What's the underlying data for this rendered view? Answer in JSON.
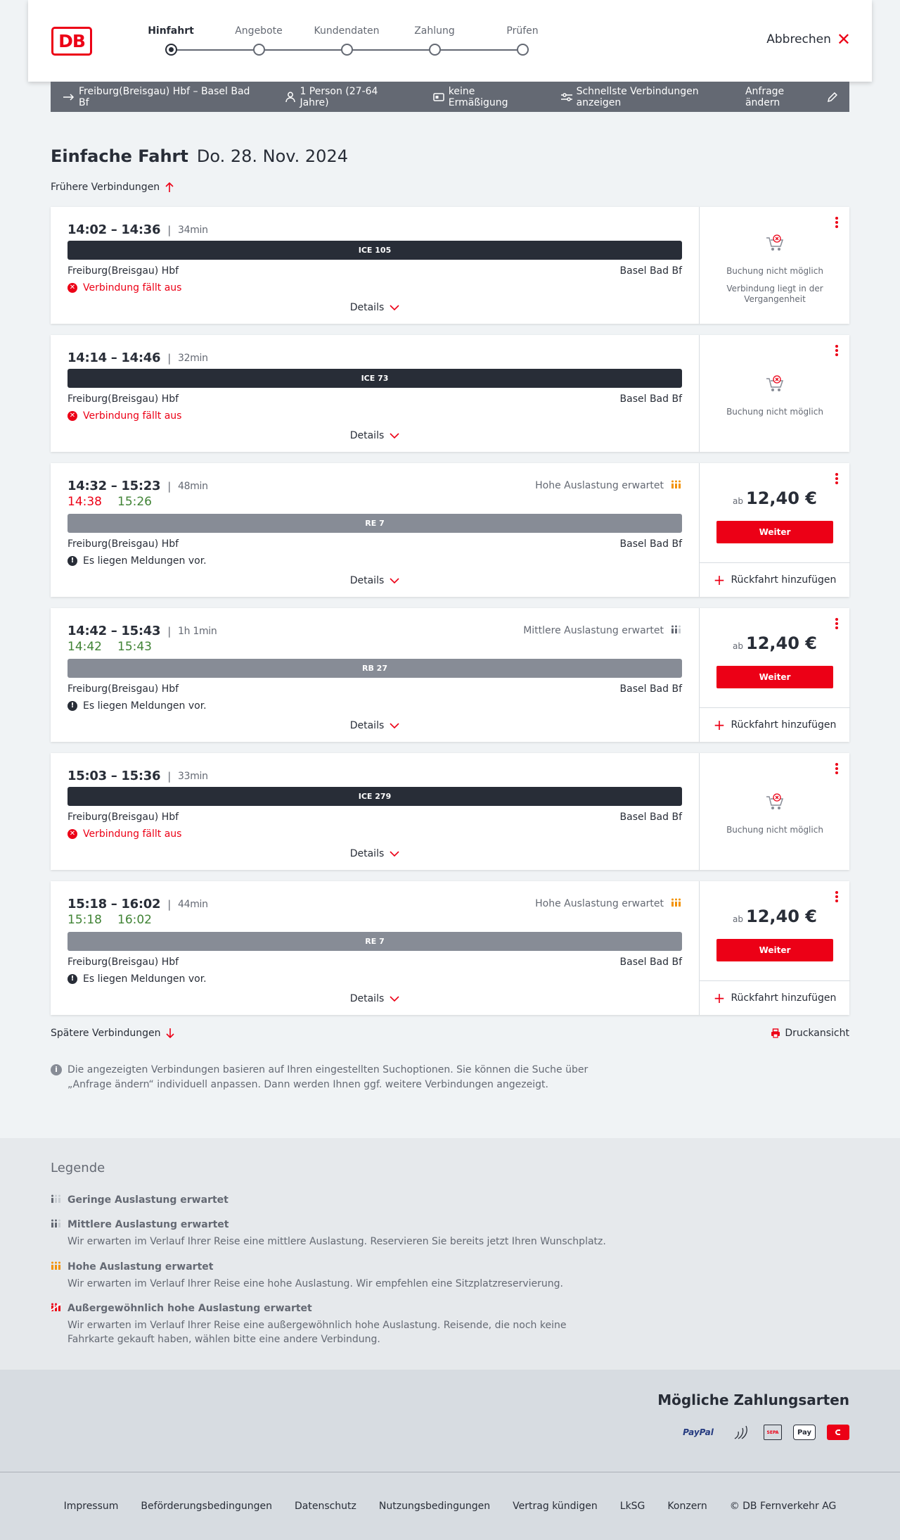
{
  "header": {
    "logo": "DB",
    "steps": [
      {
        "label": "Hinfahrt",
        "active": true
      },
      {
        "label": "Angebote",
        "active": false
      },
      {
        "label": "Kundendaten",
        "active": false
      },
      {
        "label": "Zahlung",
        "active": false
      },
      {
        "label": "Prüfen",
        "active": false
      }
    ],
    "cancel": "Abbrechen"
  },
  "query": {
    "route": "Freiburg(Breisgau) Hbf – Basel Bad Bf",
    "persons": "1 Person (27-64 Jahre)",
    "discount": "keine Ermäßigung",
    "fastest": "Schnellste Verbindungen anzeigen",
    "change": "Anfrage ändern"
  },
  "title": {
    "type": "Einfache Fahrt",
    "date": "Do. 28. Nov. 2024"
  },
  "earlier": "Frühere Verbindungen",
  "later": "Spätere Verbindungen",
  "print": "Druckansicht",
  "details_label": "Details",
  "from": "Freiburg(Breisgau) Hbf",
  "to": "Basel Bad Bf",
  "connections": [
    {
      "times": "14:02 – 14:36",
      "duration": "34min",
      "train": "ICE 105",
      "train_type": "ice",
      "notice": "Verbindung fällt aus",
      "status": "cancelled",
      "booking": "Buchung nicht möglich",
      "booking_reason": "Verbindung liegt in der Vergangenheit"
    },
    {
      "times": "14:14 – 14:46",
      "duration": "32min",
      "train": "ICE 73",
      "train_type": "ice",
      "notice": "Verbindung fällt aus",
      "status": "cancelled",
      "booking": "Buchung nicht möglich"
    },
    {
      "times": "14:32 – 15:23",
      "duration": "48min",
      "rt_dep": "14:38",
      "rt_arr": "15:26",
      "rt_dep_late": true,
      "train": "RE 7",
      "train_type": "re",
      "notice": "Es liegen Meldungen vor.",
      "status": "info",
      "load": "Hohe Auslastung erwartet",
      "load_level": "high",
      "price_prefix": "ab",
      "price": "12,40 €",
      "button": "Weiter",
      "return": "Rückfahrt hinzufügen"
    },
    {
      "times": "14:42 – 15:43",
      "duration": "1h 1min",
      "rt_dep": "14:42",
      "rt_arr": "15:43",
      "rt_dep_late": false,
      "train": "RB 27",
      "train_type": "re",
      "notice": "Es liegen Meldungen vor.",
      "status": "info",
      "load": "Mittlere Auslastung erwartet",
      "load_level": "medium",
      "price_prefix": "ab",
      "price": "12,40 €",
      "button": "Weiter",
      "return": "Rückfahrt hinzufügen"
    },
    {
      "times": "15:03 – 15:36",
      "duration": "33min",
      "train": "ICE 279",
      "train_type": "ice",
      "notice": "Verbindung fällt aus",
      "status": "cancelled",
      "booking": "Buchung nicht möglich"
    },
    {
      "times": "15:18 – 16:02",
      "duration": "44min",
      "rt_dep": "15:18",
      "rt_arr": "16:02",
      "rt_dep_late": false,
      "train": "RE 7",
      "train_type": "re",
      "notice": "Es liegen Meldungen vor.",
      "status": "info",
      "load": "Hohe Auslastung erwartet",
      "load_level": "high",
      "price_prefix": "ab",
      "price": "12,40 €",
      "button": "Weiter",
      "return": "Rückfahrt hinzufügen"
    }
  ],
  "info_text": "Die angezeigten Verbindungen basieren auf Ihren eingestellten Suchoptionen. Sie können die Suche über „Anfrage ändern“ individuell anpassen. Dann werden Ihnen ggf. weitere Verbindungen angezeigt.",
  "legend": {
    "title": "Legende",
    "items": [
      {
        "title": "Geringe Auslastung erwartet",
        "desc": "",
        "level": "low"
      },
      {
        "title": "Mittlere Auslastung erwartet",
        "desc": "Wir erwarten im Verlauf Ihrer Reise eine mittlere Auslastung. Reservieren Sie bereits jetzt Ihren Wunschplatz.",
        "level": "medium"
      },
      {
        "title": "Hohe Auslastung erwartet",
        "desc": "Wir erwarten im Verlauf Ihrer Reise eine hohe Auslastung. Wir empfehlen eine Sitzplatzreservierung.",
        "level": "high"
      },
      {
        "title": "Außergewöhnlich hohe Auslastung erwartet",
        "desc": "Wir erwarten im Verlauf Ihrer Reise eine außergewöhnlich hohe Auslastung. Reisende, die noch keine Fahrkarte gekauft haben, wählen bitte eine andere Verbindung.",
        "level": "extreme"
      }
    ]
  },
  "payment": {
    "title": "Mögliche Zahlungsarten",
    "methods": [
      {
        "label": "PayPal",
        "icon": "paypal-icon"
      },
      {
        "label": "",
        "icon": "contactless-icon"
      },
      {
        "label": "SEPA",
        "icon": "sepa-icon"
      },
      {
        "label": "Pay",
        "icon": "apple-pay-icon"
      },
      {
        "label": "",
        "icon": "db-card-icon"
      }
    ]
  },
  "footer": [
    "Impressum",
    "Beförderungsbedingungen",
    "Datenschutz",
    "Nutzungsbedingungen",
    "Vertrag kündigen",
    "LkSG",
    "Konzern",
    "© DB Fernverkehr AG"
  ],
  "colors": {
    "brand_red": "#ec0016",
    "dark": "#282d37",
    "grey": "#646973",
    "green": "#408335",
    "load_orange": "#f39200"
  }
}
